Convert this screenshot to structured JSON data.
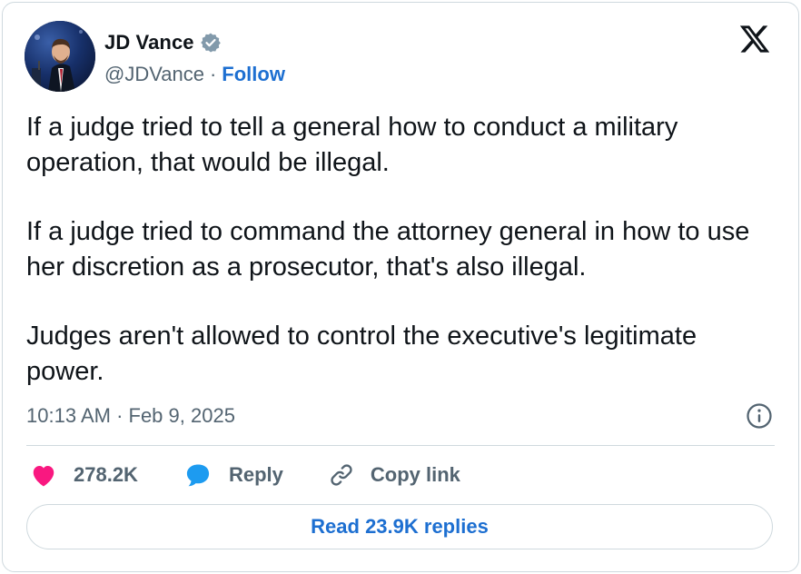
{
  "author": {
    "name": "JD Vance",
    "handle": "@JDVance",
    "separator": "·",
    "follow_label": "Follow"
  },
  "icons": {
    "verified": "verified-badge-icon",
    "logo": "x-logo-icon",
    "info": "info-icon",
    "like": "heart-icon",
    "reply": "speech-bubble-icon",
    "copy_link": "link-icon"
  },
  "tweet": {
    "paragraphs": [
      "If a judge tried to tell a general how to conduct a military operation, that would be illegal.",
      "If a judge tried to command the attorney general in how to use her discretion as a prosecutor, that's also illegal.",
      "Judges aren't allowed to control the executive's legitimate power."
    ],
    "timestamp": "10:13 AM · Feb 9, 2025"
  },
  "actions": {
    "likes": "278.2K",
    "reply_label": "Reply",
    "copy_link_label": "Copy link"
  },
  "read_replies_label": "Read 23.9K replies",
  "colors": {
    "accent": "#1d6fd1",
    "like": "#f91880",
    "reply": "#1d9bf0",
    "text": "#0f1419",
    "muted": "#536471",
    "border": "#cfd9de"
  }
}
